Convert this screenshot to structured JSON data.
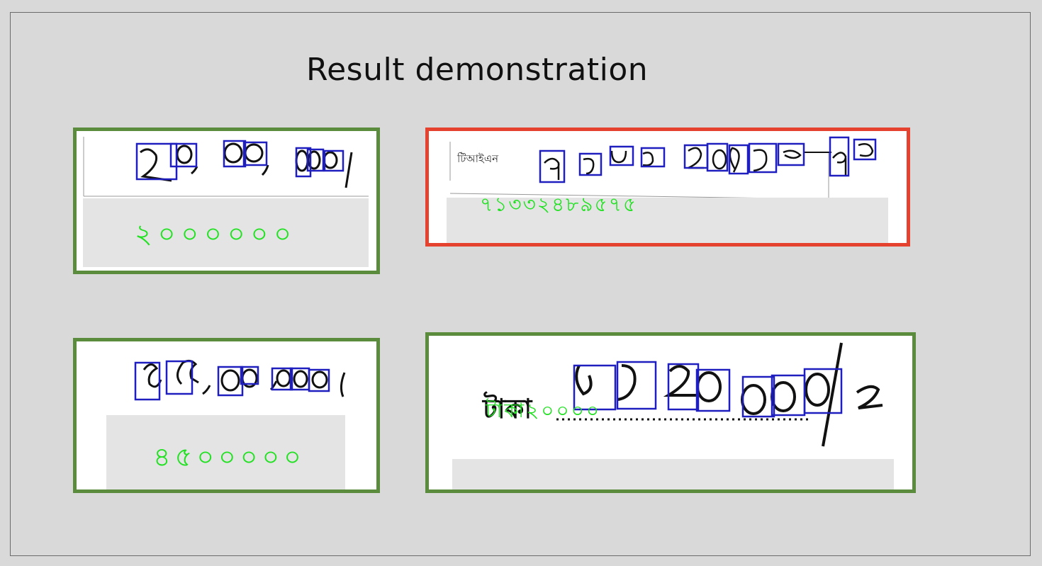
{
  "slide": {
    "title": "Result demonstration"
  },
  "colors": {
    "correct_border": "#5b8c3e",
    "wrong_border": "#e5432f",
    "detection_box": "#1f1fbf",
    "predicted_text": "#22e022"
  },
  "samples": [
    {
      "status": "correct",
      "handwritten_text": "২০,০০,০০০/-",
      "predicted_digits": "২০০০০০০"
    },
    {
      "status": "incorrect",
      "printed_label": "টিআইএন",
      "handwritten_text": "৭১৩৩২৪৮৯৫৭৫",
      "predicted_digits": "৭১৩৩২৪৮৯৫৭৫"
    },
    {
      "status": "correct",
      "handwritten_text": "৪৫,০০,০০০/-",
      "predicted_digits": "৪৫০০০০০"
    },
    {
      "status": "correct",
      "printed_label": "টাকা",
      "handwritten_text": "৫২,২০,০০০/=",
      "predicted_digits": "টাকা২০০০০"
    }
  ]
}
